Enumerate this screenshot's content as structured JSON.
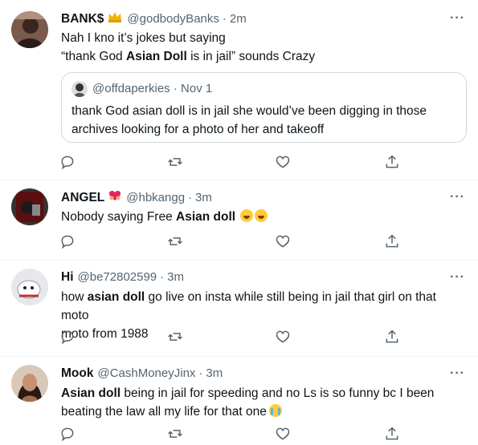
{
  "tweets": [
    {
      "name": "BANK$",
      "handle": "@godbodyBanks",
      "time": "2m",
      "badge": "crown-icon",
      "body_parts": [
        "Nah I kno it’s jokes but saying",
        "“thank God ",
        "Asian Doll",
        " is in jail” sounds Crazy"
      ],
      "quote": {
        "handle": "@offdaperkies",
        "time": "Nov 1",
        "text_line1": "thank God asian doll is in jail she would’ve been digging in those",
        "text_line2": "archives looking for a photo of her and takeoff"
      }
    },
    {
      "name": "ANGEL",
      "handle": "@hbkangg",
      "time": "3m",
      "badge": "heart-hands-icon",
      "body_parts": [
        "Nobody saying Free ",
        "Asian doll"
      ],
      "emojis": [
        "rofl-emoji",
        "rofl-emoji"
      ]
    },
    {
      "name": "Hi",
      "handle": "@be72802599",
      "time": "3m",
      "body_parts": [
        "how ",
        "asian doll",
        " go live on insta while still being in jail that girl on that moto",
        "moto from 1988"
      ]
    },
    {
      "name": "Mook",
      "handle": "@CashMoneyJinx",
      "time": "3m",
      "body_parts": [
        "Asian doll",
        " being in jail for speeding and no Ls is so funny bc I been",
        "beating the law all my life for that one"
      ],
      "emojis": [
        "loudly-crying-emoji"
      ]
    }
  ],
  "more_label": "···",
  "colors": {
    "secondary": "#536471",
    "border": "#cfd9de",
    "divider": "#eff3f4"
  }
}
